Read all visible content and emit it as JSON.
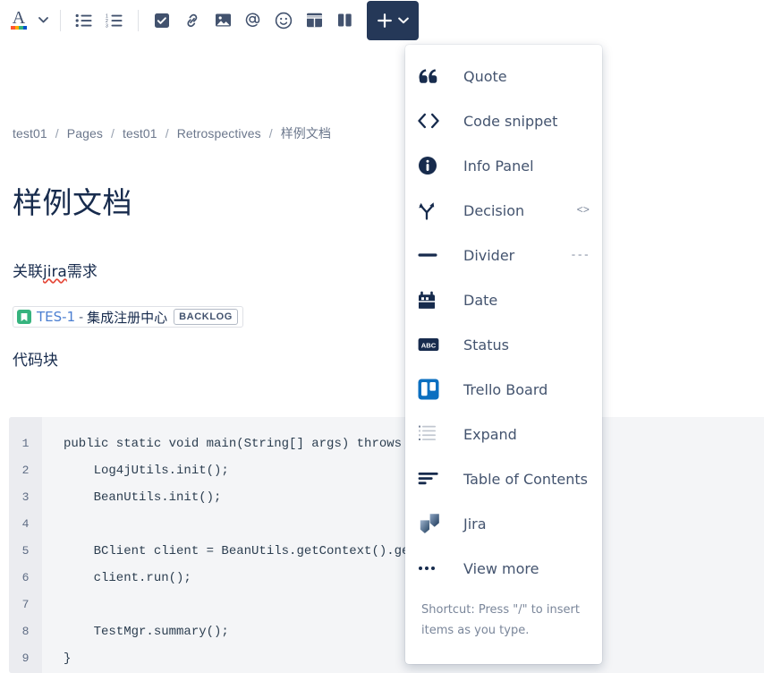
{
  "toolbar": {
    "groups": [
      {
        "items": [
          {
            "name": "text-style-button",
            "icon": "font-color-A-icon",
            "label": "Text color"
          },
          {
            "name": "text-style-caret",
            "icon": "chevron-down-icon",
            "label": "Open text style menu"
          }
        ]
      },
      {
        "items": [
          {
            "name": "bullet-list-button",
            "icon": "bullet-list-icon",
            "label": "Bullet list"
          },
          {
            "name": "numbered-list-button",
            "icon": "numbered-list-icon",
            "label": "Numbered list"
          }
        ]
      },
      {
        "items": [
          {
            "name": "task-list-button",
            "icon": "checkbox-checked-icon",
            "label": "Action item"
          },
          {
            "name": "link-button",
            "icon": "link-icon",
            "label": "Link"
          },
          {
            "name": "image-button",
            "icon": "image-icon",
            "label": "Image"
          },
          {
            "name": "mention-button",
            "icon": "at-mention-icon",
            "label": "Mention"
          },
          {
            "name": "emoji-button",
            "icon": "smiley-icon",
            "label": "Emoji"
          },
          {
            "name": "table-button",
            "icon": "table-grid-icon",
            "label": "Table"
          },
          {
            "name": "layout-button",
            "icon": "two-column-layout-icon",
            "label": "Page layout"
          }
        ]
      }
    ],
    "insert_button": {
      "name": "insert-more-button",
      "plus_icon": "plus-icon",
      "caret_icon": "chevron-down-icon",
      "label": "Insert more content"
    },
    "a_underline_colors": [
      "#FF5630",
      "#FFAB00",
      "#36B37E",
      "#0052CC"
    ]
  },
  "breadcrumb": {
    "items": [
      "test01",
      "Pages",
      "test01",
      "Retrospectives",
      "样例文档"
    ],
    "separator": "/"
  },
  "page": {
    "title": "样例文档",
    "heading_jira": "关联jira需求",
    "heading_jira_plain_prefix": "关联",
    "heading_jira_misspelled": "jira",
    "heading_jira_suffix": "需求",
    "heading_code": "代码块"
  },
  "jira_card": {
    "icon": "jira-story-bookmark-icon",
    "key": "TES-1",
    "dash": "-",
    "summary": "集成注册中心",
    "status": "BACKLOG",
    "icon_color": "#36B37E",
    "key_color": "#4C7FD1"
  },
  "code_block": {
    "line_numbers": [
      "1",
      "2",
      "3",
      "4",
      "5",
      "6",
      "7",
      "8",
      "9"
    ],
    "lines": [
      "public static void main(String[] args) throws Exception {",
      "    Log4jUtils.init();",
      "    BeanUtils.init();",
      "",
      "    BClient client = BeanUtils.getContext().getBean(BClient.class);",
      "    client.run();",
      "",
      "    TestMgr.summary();",
      "}"
    ]
  },
  "insert_menu": {
    "items": [
      {
        "name": "menu-item-quote",
        "icon": "quotation-mark-icon",
        "label": "Quote",
        "hint": ""
      },
      {
        "name": "menu-item-code-snippet",
        "icon": "code-angle-brackets-icon",
        "label": "Code snippet",
        "hint": ""
      },
      {
        "name": "menu-item-info-panel",
        "icon": "info-circle-icon",
        "label": "Info Panel",
        "hint": ""
      },
      {
        "name": "menu-item-decision",
        "icon": "decision-fork-icon",
        "label": "Decision",
        "hint": "<>"
      },
      {
        "name": "menu-item-divider",
        "icon": "horizontal-rule-icon",
        "label": "Divider",
        "hint": "---"
      },
      {
        "name": "menu-item-date",
        "icon": "calendar-date-icon",
        "label": "Date",
        "hint": ""
      },
      {
        "name": "menu-item-status",
        "icon": "abc-status-icon",
        "label": "Status",
        "hint": ""
      },
      {
        "name": "menu-item-trello-board",
        "icon": "trello-board-icon",
        "label": "Trello Board",
        "hint": ""
      },
      {
        "name": "menu-item-expand",
        "icon": "expand-list-icon",
        "label": "Expand",
        "hint": ""
      },
      {
        "name": "menu-item-table-of-contents",
        "icon": "table-of-contents-icon",
        "label": "Table of Contents",
        "hint": ""
      },
      {
        "name": "menu-item-jira",
        "icon": "jira-logo-icon",
        "label": "Jira",
        "hint": ""
      },
      {
        "name": "menu-item-view-more",
        "icon": "ellipsis-icon",
        "label": "View more",
        "hint": ""
      }
    ],
    "footer": "Shortcut: Press \"/\" to insert items as you type.",
    "trello_color": "#0B6FC0",
    "jira_color": "#1B3657"
  }
}
